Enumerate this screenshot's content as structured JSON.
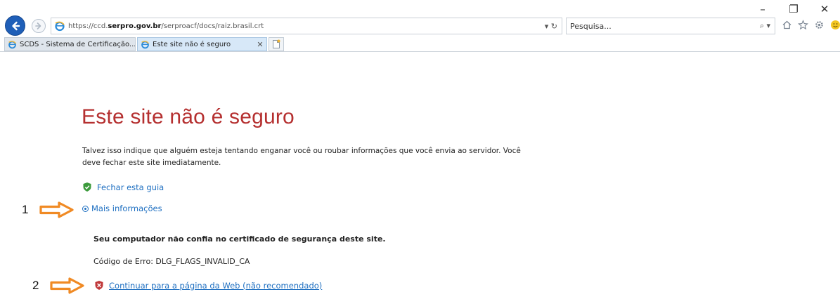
{
  "window": {
    "minimize_glyph": "–",
    "restore_glyph": "❐",
    "close_glyph": "✕"
  },
  "address_bar": {
    "url_prefix": "https://ccd.",
    "url_host": "serpro.gov.br",
    "url_suffix": "/serproacf/docs/raiz.brasil.crt",
    "tools_text": "▾ ↻"
  },
  "search": {
    "placeholder": "Pesquisa...",
    "tools_text": "⌕ ▾"
  },
  "tabs": [
    {
      "label": "SCDS - Sistema de Certificação...",
      "active": false
    },
    {
      "label": "Este site não é seguro",
      "active": true,
      "close": "✕"
    }
  ],
  "page": {
    "title": "Este site não é seguro",
    "description": "Talvez isso indique que alguém esteja tentando enganar você ou roubar informações que você envia ao servidor. Você deve fechar este site imediatamente.",
    "close_link": "Fechar esta guia",
    "more_info_link": "Mais informações",
    "cert_message": "Seu computador não confia no certificado de segurança deste site.",
    "error_code": "Código de Erro: DLG_FLAGS_INVALID_CA",
    "continue_link": "Continuar para a página da Web (não recomendado)"
  },
  "annotations": [
    {
      "number": "1"
    },
    {
      "number": "2"
    }
  ],
  "colors": {
    "title_red": "#b53030",
    "link_blue": "#1e6fc1",
    "arrow_orange": "#f08a24",
    "back_blue": "#1f5fb8"
  }
}
